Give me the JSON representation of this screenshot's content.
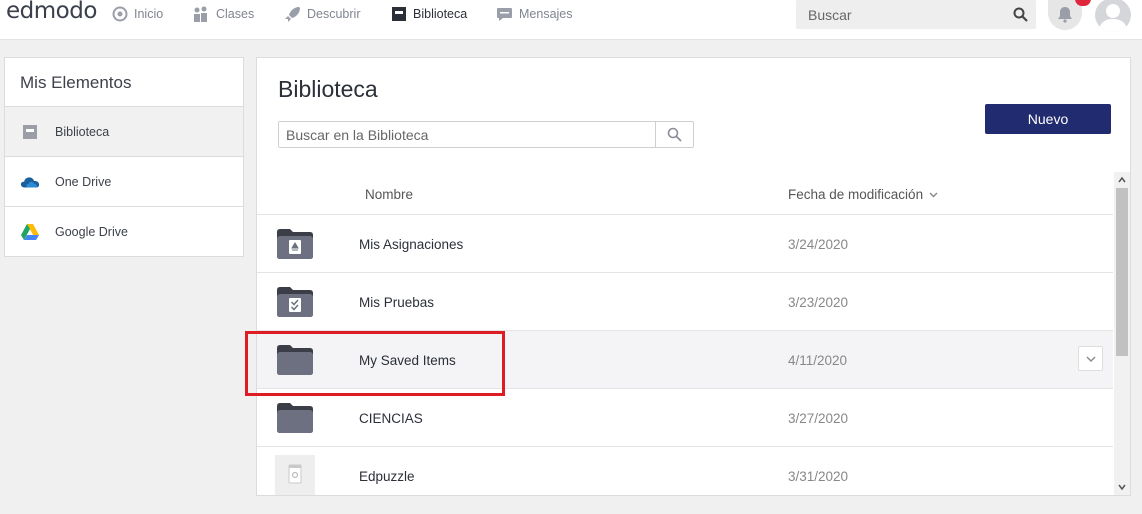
{
  "header": {
    "logo": "edmodo",
    "nav": [
      {
        "label": "Inicio",
        "icon": "home-icon"
      },
      {
        "label": "Clases",
        "icon": "classes-icon"
      },
      {
        "label": "Descubrir",
        "icon": "rocket-icon"
      },
      {
        "label": "Biblioteca",
        "icon": "library-icon"
      },
      {
        "label": "Mensajes",
        "icon": "messages-icon"
      }
    ],
    "active_nav": "Biblioteca",
    "search_placeholder": "Buscar"
  },
  "sidebar": {
    "title": "Mis Elementos",
    "items": [
      {
        "label": "Biblioteca",
        "icon": "library-icon",
        "selected": true
      },
      {
        "label": "One Drive",
        "icon": "onedrive-icon",
        "selected": false
      },
      {
        "label": "Google Drive",
        "icon": "google-drive-icon",
        "selected": false
      }
    ]
  },
  "main": {
    "title": "Biblioteca",
    "search_placeholder": "Buscar en la Biblioteca",
    "new_button": "Nuevo",
    "columns": {
      "name": "Nombre",
      "date": "Fecha de modificación"
    },
    "rows": [
      {
        "name": "Mis Asignaciones",
        "date": "3/24/2020",
        "icon": "assignment-folder-icon"
      },
      {
        "name": "Mis Pruebas",
        "date": "3/23/2020",
        "icon": "quiz-folder-icon"
      },
      {
        "name": "My Saved Items",
        "date": "4/11/2020",
        "icon": "folder-icon"
      },
      {
        "name": "CIENCIAS",
        "date": "3/27/2020",
        "icon": "folder-icon"
      },
      {
        "name": "Edpuzzle",
        "date": "3/31/2020",
        "icon": "link-file-icon"
      }
    ]
  },
  "colors": {
    "accent_button": "#212b70",
    "highlight_border": "#dd1c24",
    "folder": "#6c7080",
    "notification_badge": "#e0263a"
  }
}
